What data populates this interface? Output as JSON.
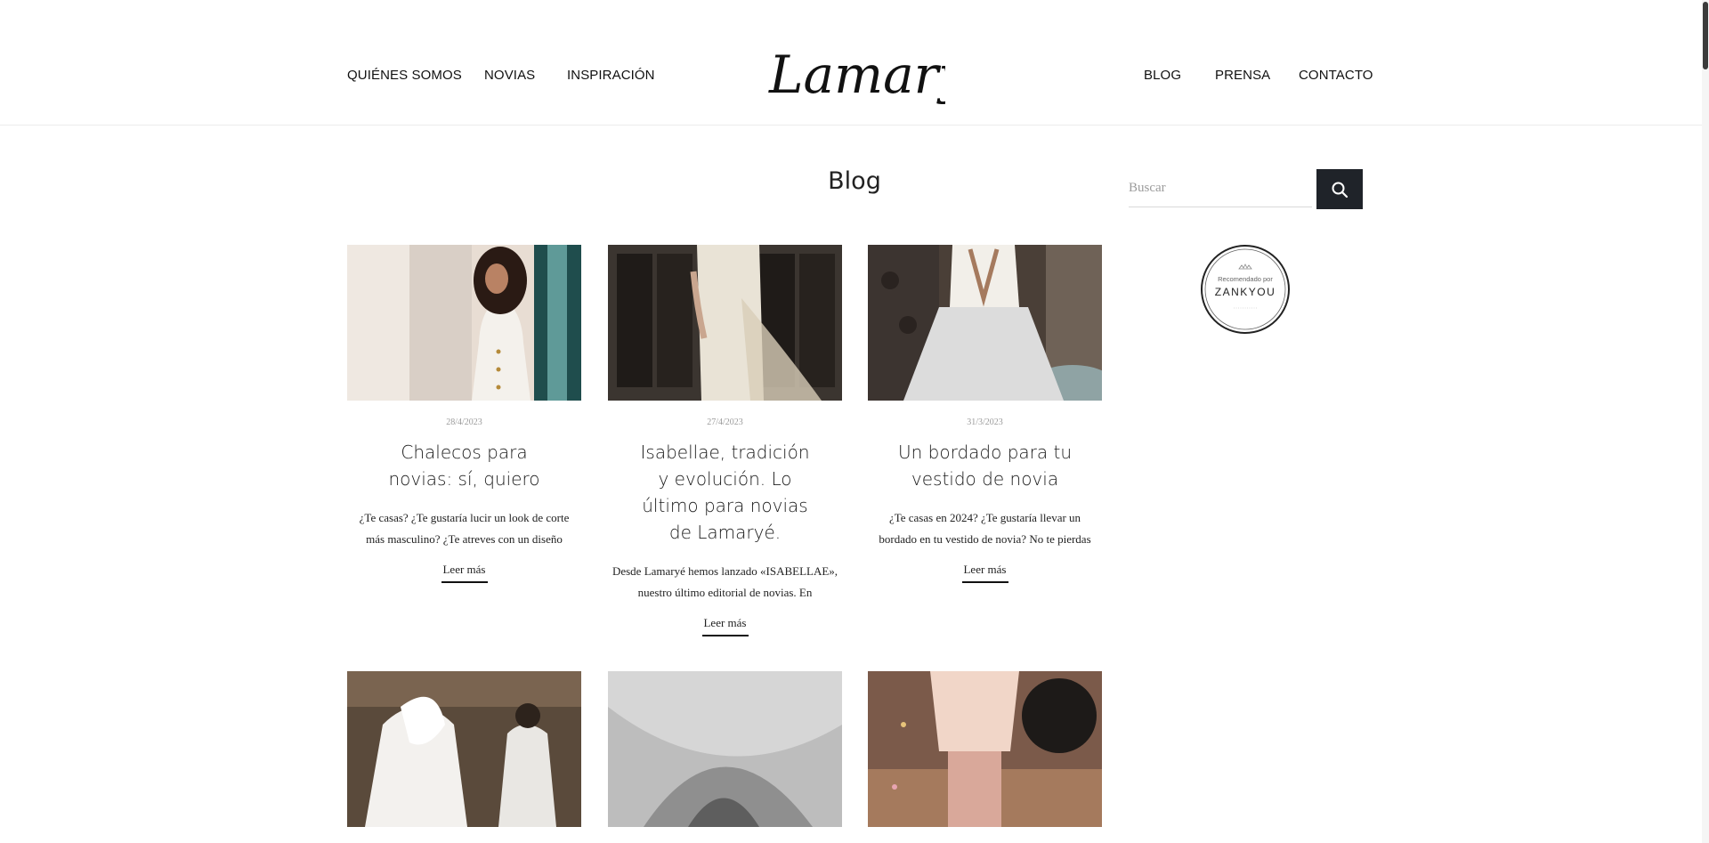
{
  "nav": {
    "left": [
      "QUIÉNES SOMOS",
      "NOVIAS",
      "INSPIRACIÓN"
    ],
    "right": [
      "BLOG",
      "PRENSA",
      "CONTACTO"
    ]
  },
  "logo": {
    "text": "Lamaryé"
  },
  "page": {
    "title": "Blog"
  },
  "search": {
    "placeholder": "Buscar"
  },
  "badge": {
    "line1": "Recomendado por",
    "line2": "ZANKYOU"
  },
  "posts": [
    {
      "date": "28/4/2023",
      "title": "Chalecos para novias: sí, quiero",
      "excerpt": "¿Te casas? ¿Te gustaría lucir un look de corte más masculino? ¿Te atreves con un diseño",
      "more": "Leer más"
    },
    {
      "date": "27/4/2023",
      "title": "Isabellae, tradición y evolución. Lo último para novias de Lamaryé.",
      "excerpt": "Desde Lamaryé hemos lanzado «ISABELLAE», nuestro último editorial de novias. En",
      "more": "Leer más"
    },
    {
      "date": "31/3/2023",
      "title": "Un bordado para tu vestido de novia",
      "excerpt": "¿Te casas en 2024? ¿Te gustaría llevar un bordado en tu vestido de novia? No te pierdas",
      "more": "Leer más"
    }
  ],
  "icons": {
    "search": "search-icon"
  },
  "colors": {
    "button": "#1f2329",
    "text": "#111111",
    "muted": "#9a9a9a"
  }
}
